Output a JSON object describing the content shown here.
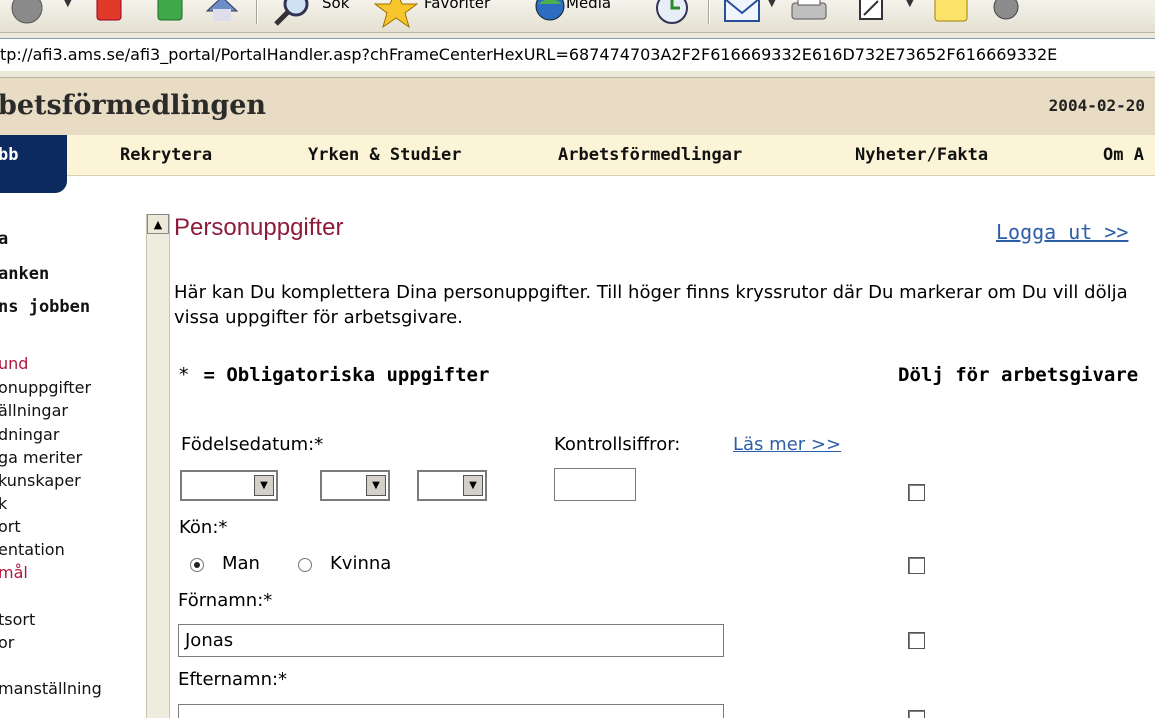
{
  "toolbar": {
    "search_label": "Sök",
    "favorites_label": "Favoriter",
    "media_label": "Media"
  },
  "address": {
    "url": "tp://afi3.ams.se/afi3_portal/PortalHandler.asp?chFrameCenterHexURL=687474703A2F2F616669332E616D732E73652F616669332E"
  },
  "site": {
    "title": "betsförmedlingen",
    "date": "2004-02-20"
  },
  "nav": {
    "active": "bb",
    "items": [
      "Rekrytera",
      "Yrken & Studier",
      "Arbetsförmedlingar",
      "Nyheter/Fakta",
      "Om A"
    ]
  },
  "left_menu": {
    "items": [
      "a",
      "anken",
      "ns jobben",
      "und",
      "onuppgifter",
      "ällningar",
      "dningar",
      "ga meriter",
      "kunskaper",
      "k",
      "ort",
      "entation",
      "mål",
      "tsort",
      "or",
      "manställning"
    ]
  },
  "page": {
    "title": "Personuppgifter",
    "logout": "Logga ut >>",
    "intro": "Här kan Du komplettera Dina personuppgifter. Till höger finns kryssrutor där Du markerar om Du vill dölja vissa uppgifter för arbetsgivare.",
    "required_star": "*",
    "required_label": "= Obligatoriska uppgifter",
    "hide_heading": "Dölj för arbetsgivare"
  },
  "form": {
    "birthdate_label": "Födelsedatum:*",
    "control_label": "Kontrollsiffror:",
    "read_more": "Läs mer >>",
    "gender_label": "Kön:*",
    "gender_options": [
      "Man",
      "Kvinna"
    ],
    "gender_selected": "Man",
    "firstname_label": "Förnamn:*",
    "firstname_value": "Jonas",
    "lastname_label": "Efternamn:*"
  }
}
